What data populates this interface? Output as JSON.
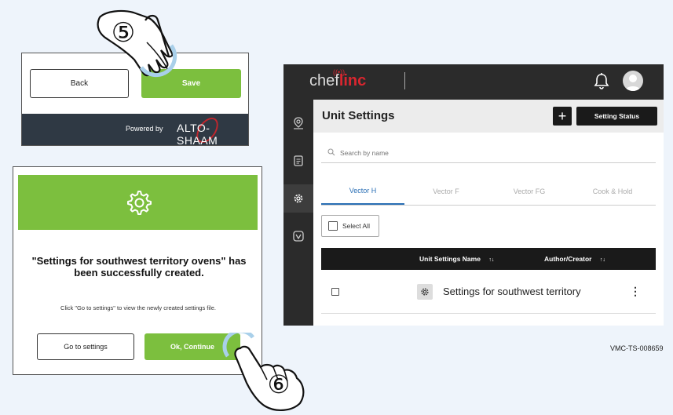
{
  "step1": {
    "step_number": "⑤",
    "back_label": "Back",
    "save_label": "Save",
    "powered_by": "Powered by",
    "brand": "ALTO-SHAAM"
  },
  "step2": {
    "step_number": "⑥",
    "message": "\"Settings for southwest territory ovens\" has been successfully created.",
    "note": "Click \"Go to settings\" to view the newly created settings file.",
    "go_to_settings": "Go to settings",
    "ok_continue": "Ok, Continue"
  },
  "app": {
    "brand_prefix": "chef",
    "brand_suffix": "linc",
    "page_title": "Unit Settings",
    "plus_label": "+",
    "setting_status": "Setting Status",
    "search_placeholder": "Search by name",
    "tabs": [
      {
        "label": "Vector H",
        "active": true
      },
      {
        "label": "Vector F",
        "active": false
      },
      {
        "label": "Vector FG",
        "active": false
      },
      {
        "label": "Cook & Hold",
        "active": false
      }
    ],
    "select_all": "Select All",
    "columns": {
      "name": "Unit Settings Name",
      "author": "Author/Creator",
      "sort_glyph": "↑↓"
    },
    "rows": [
      {
        "name": "Settings for southwest territory",
        "menu": "⋮"
      }
    ],
    "sidebar_icons": [
      "location-pin-icon",
      "document-icon",
      "gear-icon",
      "tag-icon"
    ]
  },
  "reference_code": "VMC-TS-008659",
  "colors": {
    "green": "#7cbf3e",
    "dark_footer": "#2f3944",
    "app_dark": "#2b2b2b",
    "brand_red": "#d9262f",
    "tab_blue": "#2a6fb5"
  }
}
